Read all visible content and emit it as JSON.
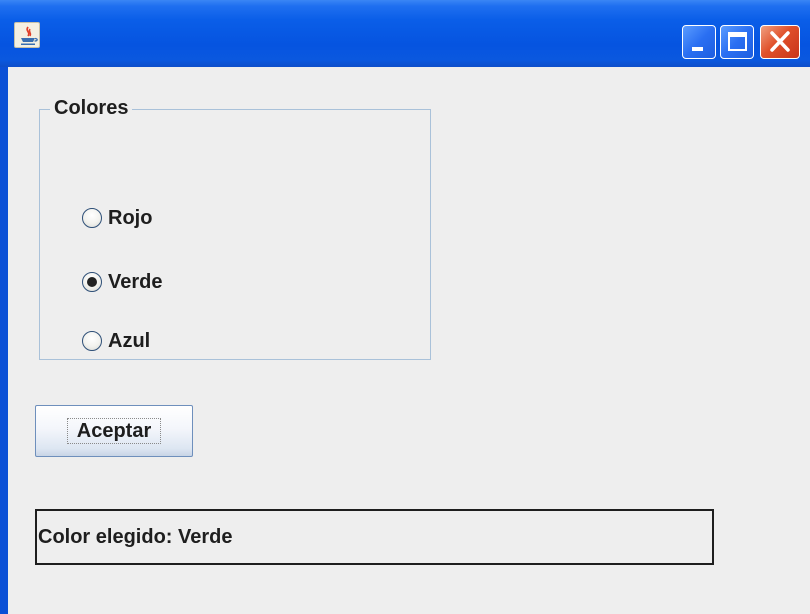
{
  "window": {
    "title": "",
    "colors": {
      "titlebar": "#0654e0",
      "client_bg": "#eeeeee",
      "close_button": "#e0502a"
    }
  },
  "titlebar_buttons": [
    {
      "name": "minimize",
      "icon": "minimize-icon"
    },
    {
      "name": "maximize",
      "icon": "maximize-icon"
    },
    {
      "name": "close",
      "icon": "close-icon"
    }
  ],
  "group": {
    "title": "Colores",
    "options": [
      {
        "label": "Rojo",
        "selected": false
      },
      {
        "label": "Verde",
        "selected": true
      },
      {
        "label": "Azul",
        "selected": false
      }
    ]
  },
  "accept_button": {
    "label": "Aceptar"
  },
  "result": {
    "text": "Color elegido: Verde"
  }
}
